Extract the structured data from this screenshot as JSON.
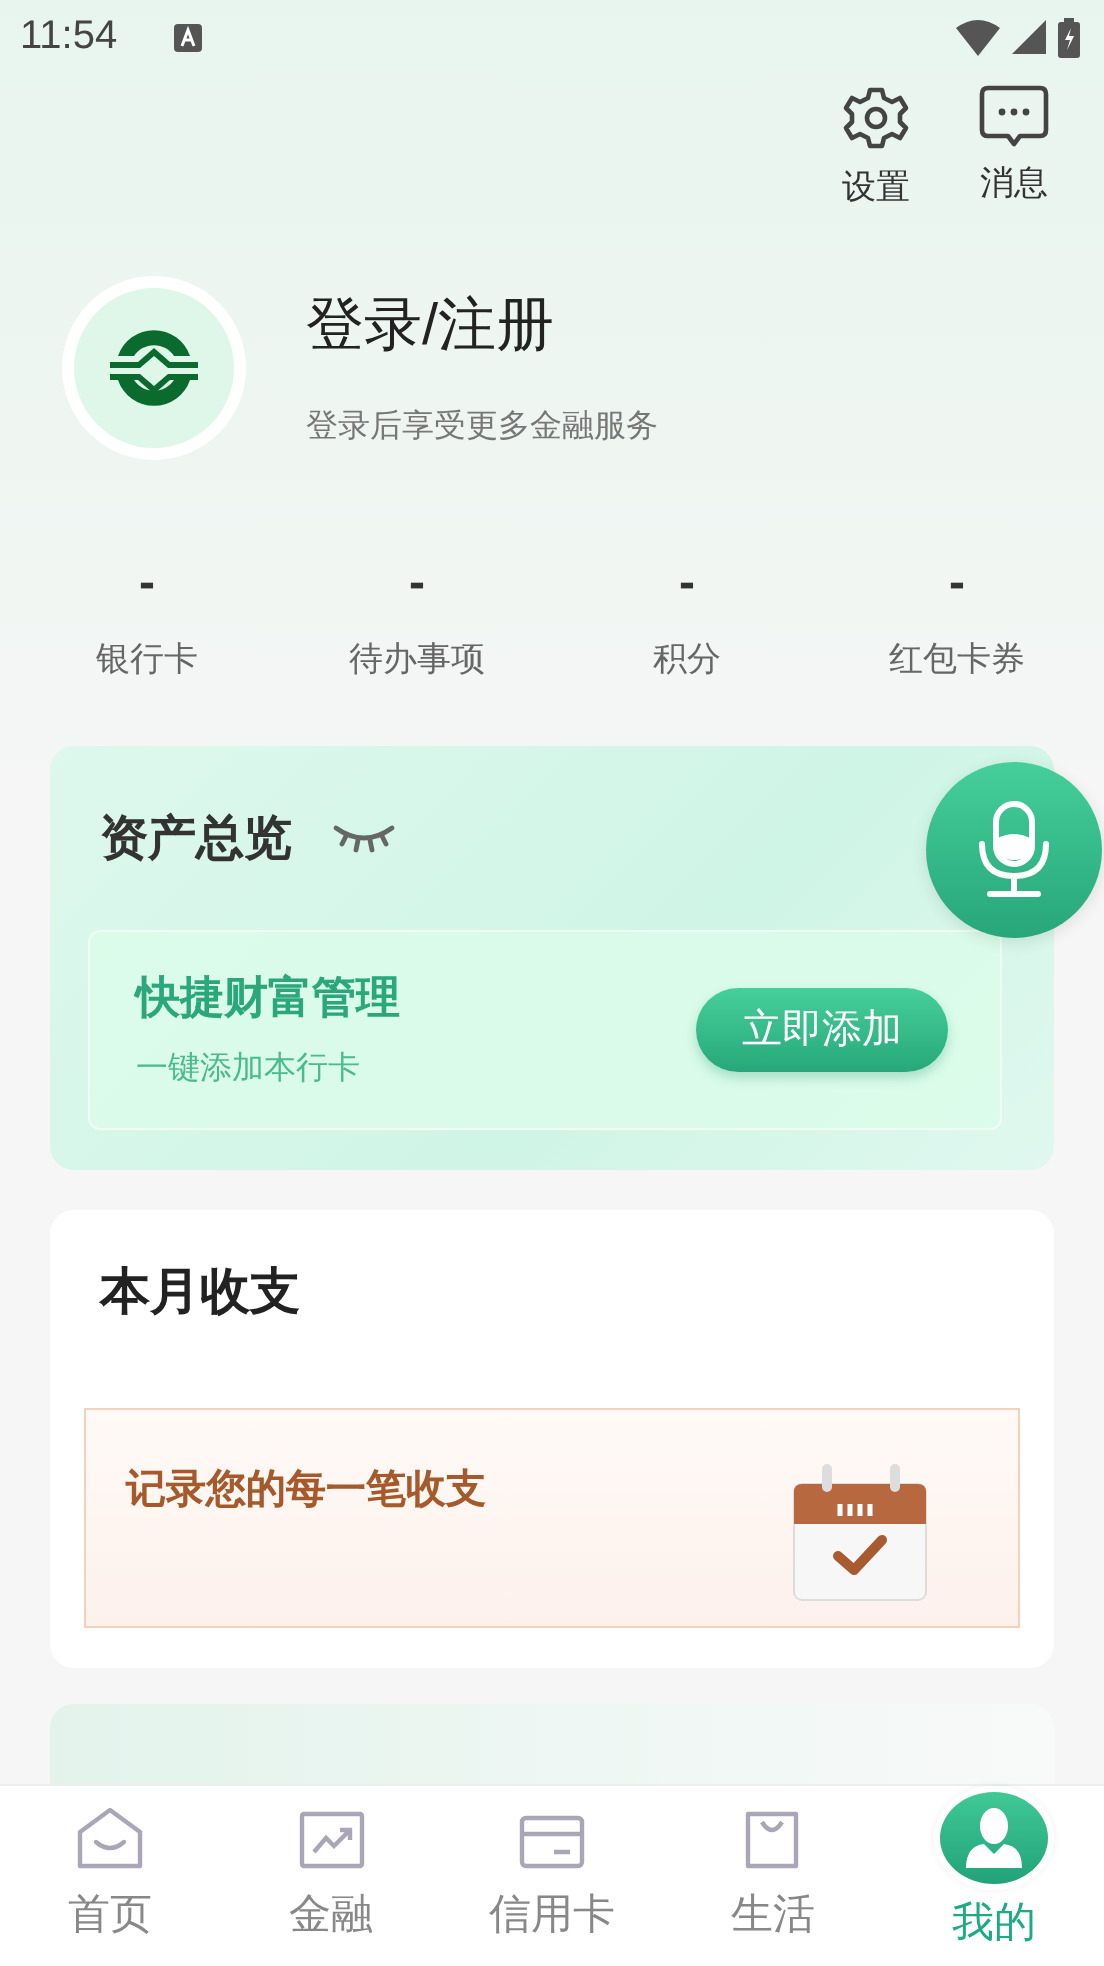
{
  "status_bar": {
    "time": "11:54"
  },
  "top_actions": [
    {
      "label": "设置"
    },
    {
      "label": "消息"
    }
  ],
  "profile": {
    "name": "登录/注册",
    "subtitle": "登录后享受更多金融服务"
  },
  "stats": [
    {
      "value": "-",
      "label": "银行卡"
    },
    {
      "value": "-",
      "label": "待办事项"
    },
    {
      "value": "-",
      "label": "积分"
    },
    {
      "value": "-",
      "label": "红包卡券"
    }
  ],
  "assets": {
    "title": "资产总览",
    "promo_title": "快捷财富管理",
    "promo_subtitle": "一键添加本行卡",
    "button": "立即添加"
  },
  "monthly": {
    "title": "本月收支",
    "banner_text": "记录您的每一笔收支"
  },
  "tabs": [
    {
      "label": "首页",
      "selected": false
    },
    {
      "label": "金融",
      "selected": false
    },
    {
      "label": "信用卡",
      "selected": false
    },
    {
      "label": "生活",
      "selected": false
    },
    {
      "label": "我的",
      "selected": true
    }
  ]
}
